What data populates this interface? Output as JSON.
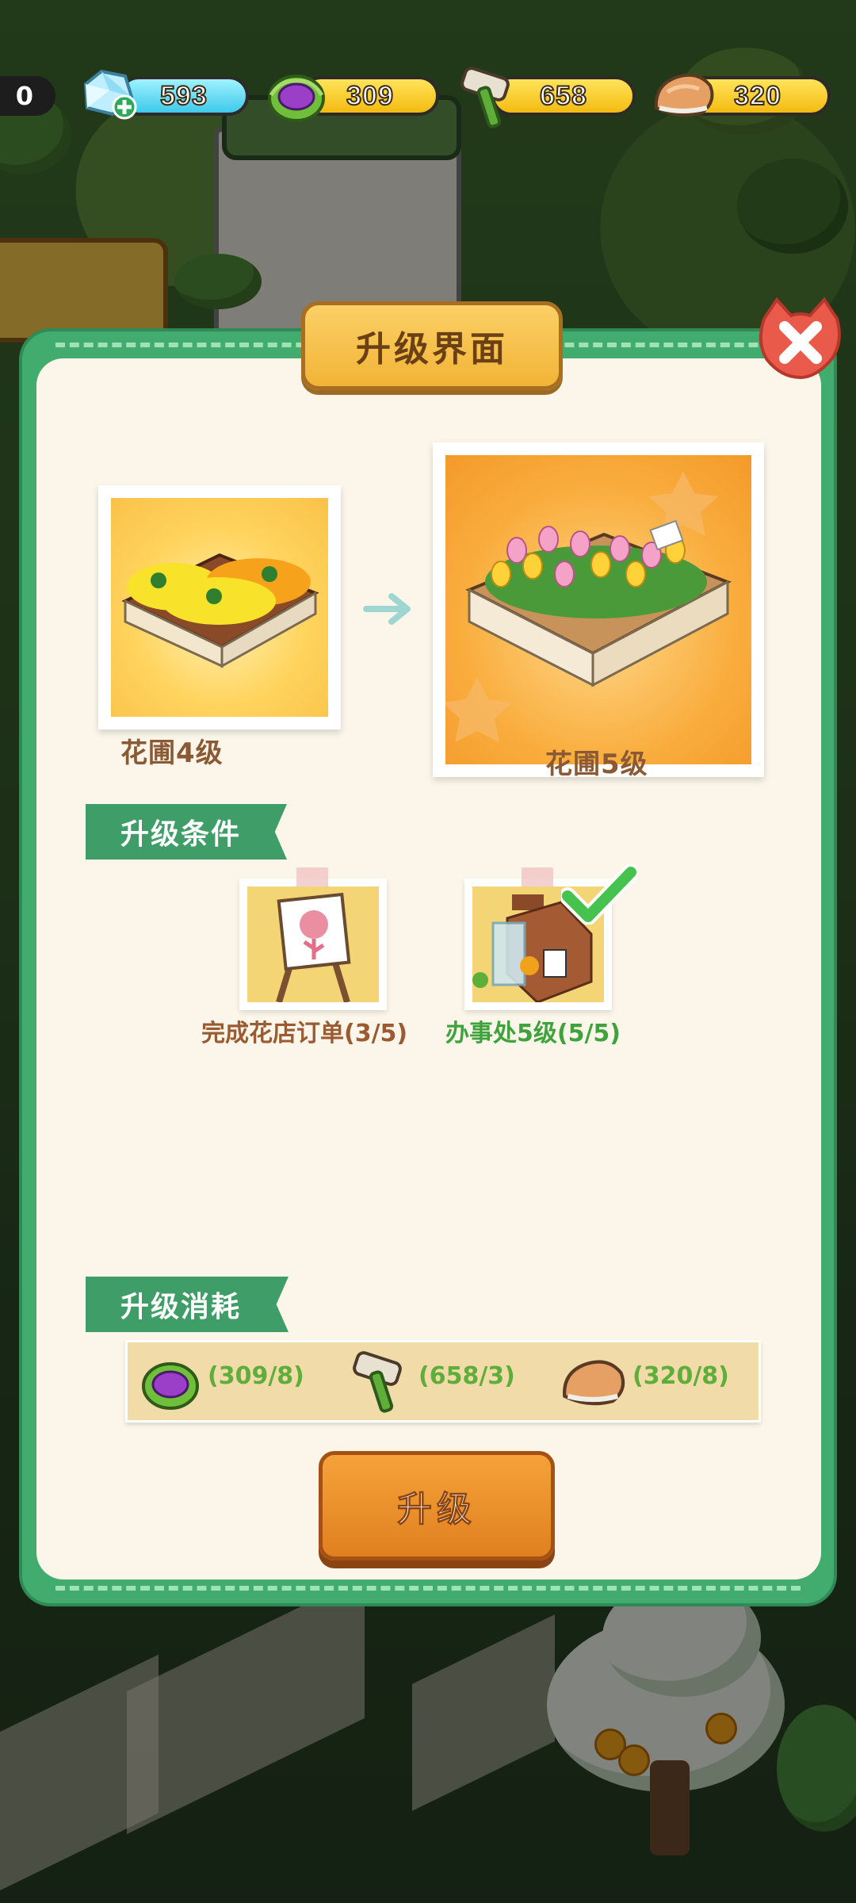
{
  "resources": {
    "partial_value": "0",
    "gems": "593",
    "cabbage": "309",
    "hammer": "658",
    "stone": "320"
  },
  "dialog": {
    "title": "升级界面",
    "current": {
      "label": "花圃4级"
    },
    "next": {
      "label": "花圃5级"
    },
    "conditions_header": "升级条件",
    "conditions": [
      {
        "text": "完成花店订单(3/5)",
        "met": false,
        "color": "#9a5a32"
      },
      {
        "text": "办事处5级(5/5)",
        "met": true,
        "color": "#3ea33c"
      }
    ],
    "cost_header": "升级消耗",
    "costs": [
      {
        "icon": "cabbage-icon",
        "text": "(309/8)"
      },
      {
        "icon": "hammer-icon",
        "text": "(658/3)"
      },
      {
        "icon": "stone-icon",
        "text": "(320/8)"
      }
    ],
    "upgrade_button": "升级"
  },
  "colors": {
    "frame_green": "#41ac6e",
    "panel_cream": "#fbf6e9",
    "title_gold": "#f2b437",
    "button_orange": "#e8872a",
    "close_red": "#ea5a4a"
  }
}
